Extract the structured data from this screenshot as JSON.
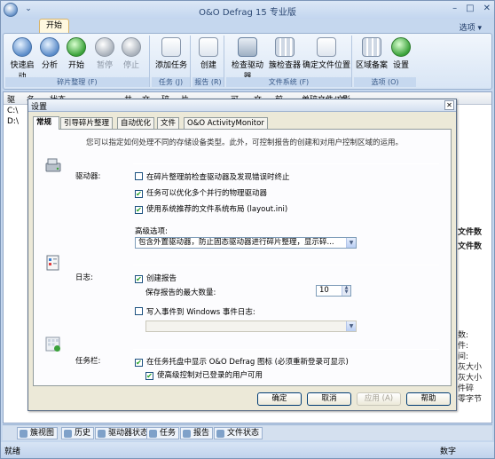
{
  "app": {
    "title": "O&O Defrag 15 专业版",
    "ribbon_tab": "开始",
    "options_menu": "选项 ▾",
    "window_controls": [
      "–",
      "□",
      "✕"
    ],
    "groups": [
      {
        "label": "碎片整理 (F)",
        "buttons": [
          "快速启动",
          "分析",
          "开始",
          "暂停",
          "停止"
        ]
      },
      {
        "label": "任务 (J)",
        "buttons": [
          "添加任务"
        ]
      },
      {
        "label": "报告 (R)",
        "buttons": [
          "创建"
        ]
      },
      {
        "label": "文件系统 (F)",
        "buttons": [
          "检查驱动器",
          "簇检查器",
          "确定文件位置"
        ]
      },
      {
        "label": "选项 (O)",
        "buttons": [
          "区域备案",
          "设置"
        ]
      }
    ],
    "list_headers": [
      "驱",
      "名",
      "状态",
      "共",
      "文",
      "碎",
      "片",
      "可",
      "文",
      "前",
      "单碎文件/文",
      "影"
    ],
    "drives": [
      "C:\\",
      "D:\\"
    ],
    "right_edge_texts": [
      "文件数",
      "文件数",
      "数:",
      "件:",
      "间:",
      "灰大小",
      "灰大小",
      "件碎",
      "零字节"
    ],
    "bottom_tabs": [
      "簇视图",
      "历史",
      "驱动器状态",
      "任务",
      "报告",
      "文件状态"
    ],
    "status_left": "就绪",
    "status_right": "数字"
  },
  "dialog": {
    "title": "设置",
    "close": "✕",
    "tabs": [
      "常规",
      "引导碎片整理",
      "自动优化",
      "文件",
      "O&O ActivityMonitor"
    ],
    "description": "您可以指定如何处理不同的存储设备类型。此外，可控制报告的创建和对用户控制区域的运用。",
    "drives_label": "驱动器:",
    "drive_options": [
      {
        "label": "在碎片整理前检查驱动器及发现错误时终止",
        "checked": false
      },
      {
        "label": "任务可以优化多个并行的物理驱动器",
        "checked": true
      },
      {
        "label": "使用系统推荐的文件系统布局 (layout.ini)",
        "checked": true
      }
    ],
    "advanced_label": "高级选项:",
    "advanced_value": "包含外置驱动器，防止固态驱动器进行碎片整理，显示碎...",
    "log_label": "日志:",
    "create_report": {
      "label": "创建报告",
      "checked": true
    },
    "max_reports_label": "保存报告的最大数量:",
    "max_reports_value": "10",
    "write_event": {
      "label": "写入事件到 Windows 事件日志:",
      "checked": false
    },
    "event_combo_value": "",
    "taskbar_label": "任务栏:",
    "taskbar_options": [
      {
        "label": "在任务托盘中显示 O&O Defrag 图标 (必须重新登录可显示)",
        "checked": true
      },
      {
        "label": "使高级控制对已登录的用户可用",
        "checked": true
      }
    ],
    "buttons": {
      "ok": "确定",
      "cancel": "取消",
      "apply": "应用 (A)",
      "help": "帮助"
    }
  }
}
